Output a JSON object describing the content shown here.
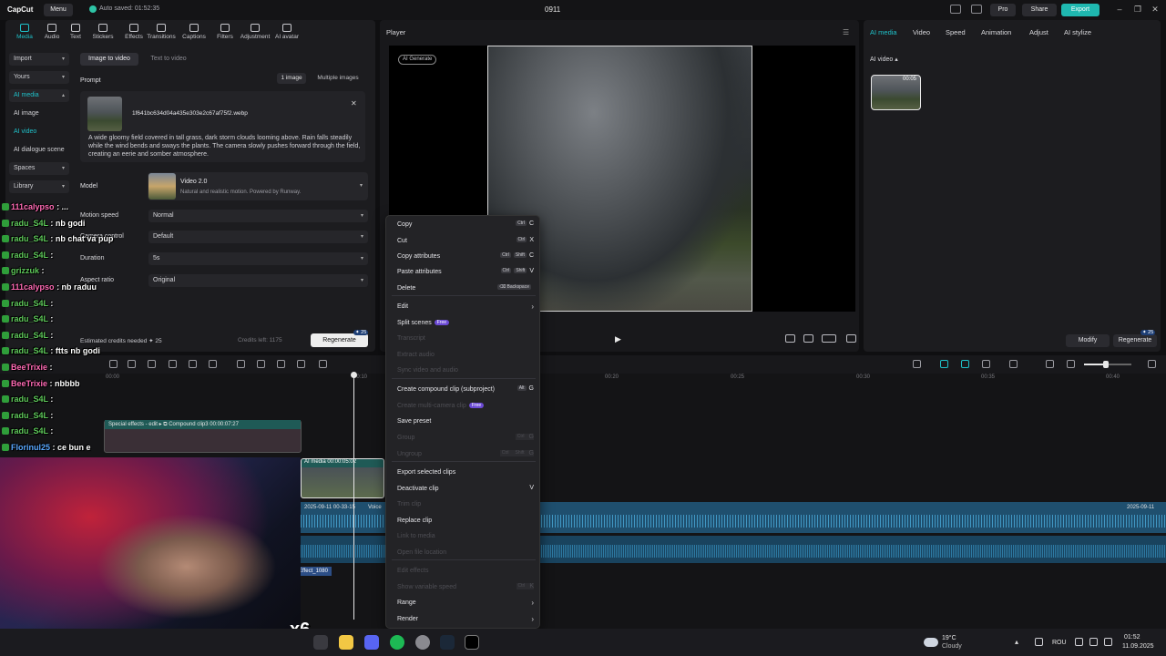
{
  "app": {
    "logo": "CapCut",
    "menu_label": "Menu",
    "autosave": "Auto saved: 01:52:35",
    "project_title": "0911",
    "pro_label": "Pro",
    "share_label": "Share",
    "export_label": "Export"
  },
  "toolbar_tabs": [
    "Media",
    "Audio",
    "Text",
    "Stickers",
    "Effects",
    "Transitions",
    "Captions",
    "Filters",
    "Adjustment",
    "AI avatar"
  ],
  "sidebar": [
    {
      "label": "Import",
      "chev": "▾"
    },
    {
      "label": "Yours",
      "chev": "▾"
    },
    {
      "label": "AI media",
      "chev": "▴"
    },
    {
      "label": "AI image",
      "chev": ""
    },
    {
      "label": "AI video",
      "chev": ""
    },
    {
      "label": "AI dialogue scene",
      "chev": ""
    },
    {
      "label": "Spaces",
      "chev": "▾"
    },
    {
      "label": "Library",
      "chev": "▾"
    }
  ],
  "generate": {
    "mode_image": "Image to video",
    "mode_text": "Text to video",
    "prompt_label": "Prompt",
    "one_image": "1 image",
    "multi_images": "Multiple images",
    "file_name": "1f641bc634d04a435e303e2c67af75f2.webp",
    "prompt_text": "A wide gloomy field covered in tall grass, dark storm clouds looming above. Rain falls steadily while the wind bends and sways the plants. The camera slowly pushes forward through the field, creating an eerie and somber atmosphere.",
    "model_label": "Model",
    "model_name": "Video 2.0",
    "model_desc": "Natural and realistic motion. Powered by Runway.",
    "params": [
      {
        "label": "Motion speed",
        "value": "Normal"
      },
      {
        "label": "Camera control",
        "value": "Default"
      },
      {
        "label": "Duration",
        "value": "5s"
      },
      {
        "label": "Aspect ratio",
        "value": "Original"
      }
    ],
    "credits_est": "Estimated credits needed  ✦ 25",
    "credits_left": "Credits left: 1175",
    "regenerate": "Regenerate",
    "regen_badge": "✦ 25"
  },
  "player": {
    "title": "Player",
    "ai_tag": "AI Generate",
    "play_icon": "play-icon"
  },
  "right_panel": {
    "tabs": [
      "AI media",
      "Video",
      "Speed",
      "Animation",
      "Adjust",
      "AI stylize"
    ],
    "section": "AI video ▴",
    "thumb_duration": "00:05",
    "modify": "Modify",
    "regenerate": "Regenerate",
    "regen_badge": "✦ 25"
  },
  "timeline": {
    "ruler": [
      "00:00",
      "00:10",
      "00:20",
      "00:25",
      "00:30",
      "00:35",
      "00:40"
    ],
    "clip_effects": "Special effects - edit ▸   ⧉ Compound clip3   00:00:07:27",
    "clip_ai": "AI media   00:00:05:02",
    "audio_1": "2025-09-11 00-33-15",
    "audio_1b": "Voice",
    "audio_2": "2025-09-11",
    "effect": "Effect_1080"
  },
  "chat": [
    {
      "user": "111calypso",
      "msg": ": ..."
    },
    {
      "user": "radu_S4L",
      "msg": ": nb godi"
    },
    {
      "user": "radu_S4L",
      "msg": ": nb chat va pup"
    },
    {
      "user": "radu_S4L",
      "msg": ":"
    },
    {
      "user": "grizzuk",
      "msg": ":"
    },
    {
      "user": "111calypso",
      "msg": ": nb raduu"
    },
    {
      "user": "radu_S4L",
      "msg": ":"
    },
    {
      "user": "radu_S4L",
      "msg": ":"
    },
    {
      "user": "radu_S4L",
      "msg": ":"
    },
    {
      "user": "radu_S4L",
      "msg": ": ftts nb godi"
    },
    {
      "user": "BeeTrixie",
      "msg": ":"
    },
    {
      "user": "BeeTrixie",
      "msg": ": nbbbb"
    },
    {
      "user": "radu_S4L",
      "msg": ":"
    },
    {
      "user": "radu_S4L",
      "msg": ":"
    },
    {
      "user": "radu_S4L",
      "msg": ":"
    },
    {
      "user": "Florinul25",
      "msg": ": ce bun e"
    }
  ],
  "webcam_overlay": "x6",
  "context_menu": [
    {
      "label": "Copy",
      "keys": [
        "Ctrl"
      ],
      "key": "C",
      "disabled": false
    },
    {
      "label": "Cut",
      "keys": [
        "Ctrl"
      ],
      "key": "X",
      "disabled": false
    },
    {
      "label": "Copy attributes",
      "keys": [
        "Ctrl",
        "Shift"
      ],
      "key": "C",
      "disabled": false
    },
    {
      "label": "Paste attributes",
      "keys": [
        "Ctrl",
        "Shift"
      ],
      "key": "V",
      "disabled": false
    },
    {
      "label": "Delete",
      "keys": [
        "⌫ Backspace"
      ],
      "key": "",
      "disabled": false
    },
    {
      "label": "Edit",
      "arrow": true,
      "disabled": false
    },
    {
      "label": "Split scenes",
      "badge": "Free",
      "disabled": false
    },
    {
      "label": "Transcript",
      "disabled": true
    },
    {
      "label": "Extract audio",
      "disabled": true
    },
    {
      "label": "Sync video and audio",
      "disabled": true
    },
    {
      "label": "Create compound clip (subproject)",
      "keys": [
        "Alt"
      ],
      "key": "G",
      "disabled": false
    },
    {
      "label": "Create multi-camera clip",
      "badge": "Free",
      "disabled": true
    },
    {
      "label": "Save preset",
      "disabled": false
    },
    {
      "label": "Group",
      "keys": [
        "Ctrl"
      ],
      "key": "G",
      "disabled": true
    },
    {
      "label": "Ungroup",
      "keys": [
        "Ctrl",
        "Shift"
      ],
      "key": "G",
      "disabled": true
    },
    {
      "label": "Export selected clips",
      "disabled": false
    },
    {
      "label": "Deactivate clip",
      "key": "V",
      "disabled": false
    },
    {
      "label": "Trim clip",
      "disabled": true
    },
    {
      "label": "Replace clip",
      "disabled": false
    },
    {
      "label": "Link to media",
      "disabled": true
    },
    {
      "label": "Open file location",
      "disabled": true
    },
    {
      "label": "Edit effects",
      "disabled": true
    },
    {
      "label": "Show variable speed",
      "keys": [
        "Ctrl"
      ],
      "key": "K",
      "disabled": true
    },
    {
      "label": "Range",
      "arrow": true,
      "disabled": false
    },
    {
      "label": "Render",
      "arrow": true,
      "disabled": false
    }
  ],
  "taskbar": {
    "temp": "19°C",
    "condition": "Cloudy",
    "lang": "ROU",
    "time": "01:52",
    "date": "11.09.2025"
  },
  "colors": {
    "accent": "#1fc1c9",
    "export": "#1fb8b0",
    "bg": "#0f0f11"
  }
}
